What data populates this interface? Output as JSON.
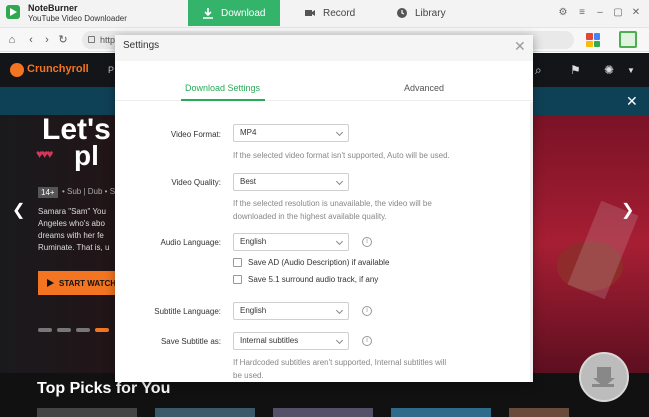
{
  "app": {
    "name": "NoteBurner",
    "subtitle": "YouTube Video Downloader"
  },
  "nav": {
    "download": "Download",
    "record": "Record",
    "library": "Library"
  },
  "browser": {
    "url": "http"
  },
  "site": {
    "brand": "Crunchyroll",
    "nav_partial": "P",
    "hero": {
      "title_line1": "Let's",
      "title_line2": "pl",
      "hearts": "♥♥♥",
      "rating": "14+",
      "audio": "• Sub | Dub • S",
      "synopsis": [
        "Samara \"Sam\" You",
        "Angeles who's abo",
        "dreams with her fe",
        "Ruminate. That is, u"
      ],
      "start_label": "START WATCH"
    },
    "section_title": "Top Picks for You"
  },
  "dialog": {
    "title": "Settings",
    "tabs": {
      "download": "Download Settings",
      "advanced": "Advanced"
    },
    "video_format": {
      "label": "Video Format:",
      "value": "MP4",
      "help": "If the selected video format isn't supported, Auto will be used."
    },
    "video_quality": {
      "label": "Video Quality:",
      "value": "Best",
      "help_line1": "If the selected resolution is unavailable, the video will be",
      "help_line2": "downloaded in the highest available quality."
    },
    "audio_language": {
      "label": "Audio Language:",
      "value": "English"
    },
    "checkboxes": {
      "ad": "Save AD (Audio Description) if available",
      "surround": "Save 5.1 surround audio track, if any"
    },
    "subtitle_language": {
      "label": "Subtitle Language:",
      "value": "English"
    },
    "save_subtitle": {
      "label": "Save Subtitle as:",
      "value": "Internal subtitles",
      "help_line1": "If Hardcoded subtitles aren't supported, Internal subtitles will",
      "help_line2": "be used."
    }
  }
}
